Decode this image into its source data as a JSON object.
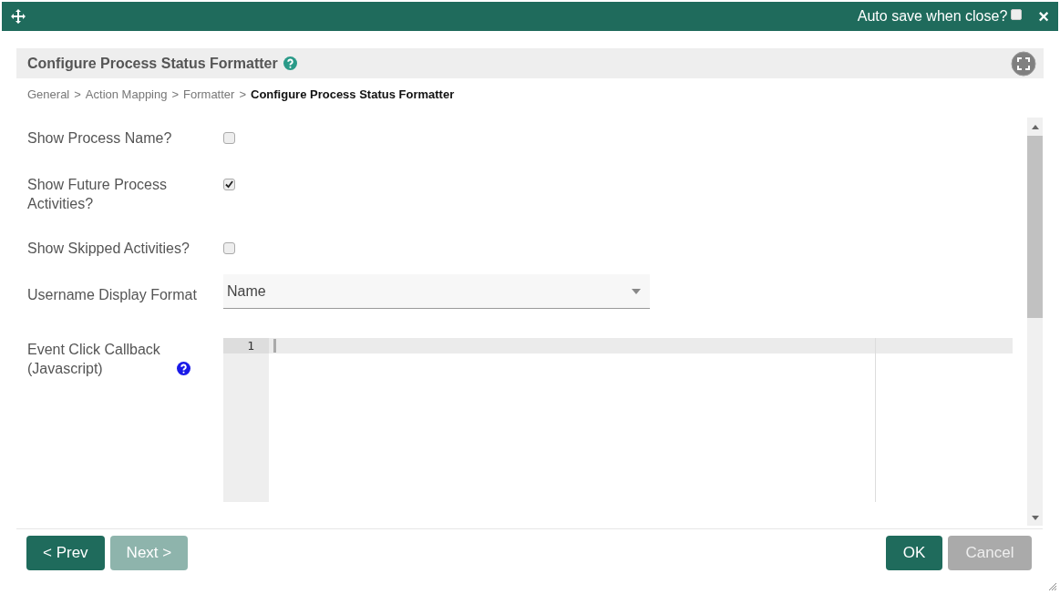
{
  "window": {
    "auto_save_label": "Auto save when close?",
    "auto_save_checked": false,
    "close": "×"
  },
  "panel": {
    "title": "Configure Process Status Formatter"
  },
  "breadcrumb": [
    {
      "label": "General",
      "current": false
    },
    {
      "label": "Action Mapping",
      "current": false
    },
    {
      "label": "Formatter",
      "current": false
    },
    {
      "label": "Configure Process Status Formatter",
      "current": true
    }
  ],
  "breadcrumb_separator": ">",
  "fields": [
    {
      "kind": "checkbox",
      "label": "Show Process Name?",
      "checked": false
    },
    {
      "kind": "checkbox",
      "label": "Show Future Process Activities?",
      "checked": true
    },
    {
      "kind": "checkbox",
      "label": "Show Skipped Activities?",
      "checked": false
    },
    {
      "kind": "select",
      "label": "Username Display Format",
      "value": "Name"
    },
    {
      "kind": "code",
      "label": "Event Click Callback (Javascript)",
      "help": true,
      "line_numbers": [
        "1"
      ]
    }
  ],
  "buttons_left": [
    {
      "label": "< Prev",
      "kind": "primary",
      "disabled": false
    },
    {
      "label": "Next >",
      "kind": "primary",
      "disabled": true
    }
  ],
  "buttons_right": [
    {
      "label": "OK",
      "kind": "primary",
      "disabled": false
    },
    {
      "label": "Cancel",
      "kind": "secondary",
      "disabled": false
    }
  ]
}
